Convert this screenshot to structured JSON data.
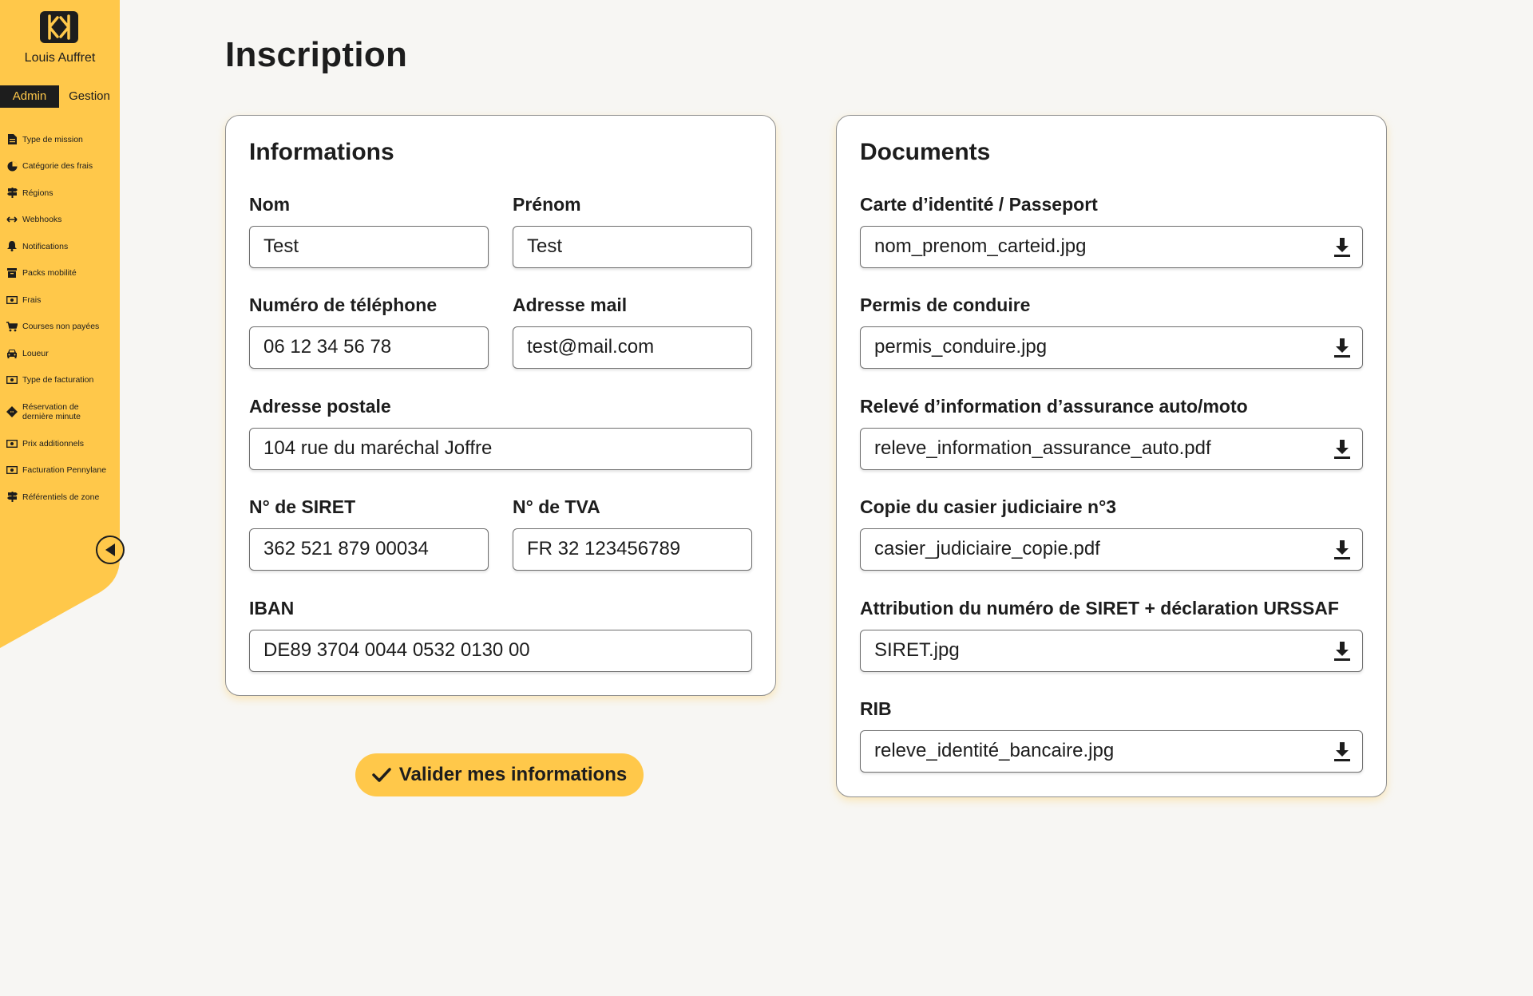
{
  "colors": {
    "accent": "#ffc84a",
    "dark": "#1d1d1d",
    "background": "#f7f6f3",
    "card": "#ffffff"
  },
  "sidebar": {
    "user_name": "Louis Auffret",
    "roles": {
      "admin": "Admin",
      "gestion": "Gestion"
    },
    "items": [
      {
        "label": "Type de mission",
        "icon": "document-icon"
      },
      {
        "label": "Catégorie des frais",
        "icon": "pie-chart-icon"
      },
      {
        "label": "Régions",
        "icon": "signpost-icon"
      },
      {
        "label": "Webhooks",
        "icon": "arrows-horizontal-icon"
      },
      {
        "label": "Notifications",
        "icon": "bell-icon"
      },
      {
        "label": "Packs mobilité",
        "icon": "package-icon"
      },
      {
        "label": "Frais",
        "icon": "money-icon"
      },
      {
        "label": "Courses non payées",
        "icon": "cart-icon"
      },
      {
        "label": "Loueur",
        "icon": "car-icon"
      },
      {
        "label": "Type de facturation",
        "icon": "money-icon"
      },
      {
        "label": "Réservation de dernière minute",
        "icon": "ticket-icon"
      },
      {
        "label": "Prix additionnels",
        "icon": "money-icon"
      },
      {
        "label": "Facturation Pennylane",
        "icon": "money-icon"
      },
      {
        "label": "Référentiels de zone",
        "icon": "signpost-icon"
      }
    ]
  },
  "page": {
    "title": "Inscription"
  },
  "informations": {
    "title": "Informations",
    "nom": {
      "label": "Nom",
      "value": "Test"
    },
    "prenom": {
      "label": "Prénom",
      "value": "Test"
    },
    "telephone": {
      "label": "Numéro de téléphone",
      "value": "06 12 34 56 78"
    },
    "email": {
      "label": "Adresse mail",
      "value": "test@mail.com"
    },
    "adresse": {
      "label": "Adresse postale",
      "value": "104 rue du maréchal Joffre"
    },
    "siret": {
      "label": "N° de SIRET",
      "value": "362 521 879 00034"
    },
    "tva": {
      "label": "N° de TVA",
      "value": "FR 32 123456789"
    },
    "iban": {
      "label": "IBAN",
      "value": "DE89 3704 0044 0532 0130 00"
    }
  },
  "documents": {
    "title": "Documents",
    "items": [
      {
        "label": "Carte d’identité / Passeport",
        "file": "nom_prenom_carteid.jpg"
      },
      {
        "label": "Permis de conduire",
        "file": "permis_conduire.jpg"
      },
      {
        "label": "Relevé d’information d’assurance auto/moto",
        "file": "releve_information_assurance_auto.pdf"
      },
      {
        "label": "Copie du casier judiciaire n°3",
        "file": "casier_judiciaire_copie.pdf"
      },
      {
        "label": "Attribution du numéro de SIRET + déclaration URSSAF",
        "file": "SIRET.jpg"
      },
      {
        "label": "RIB",
        "file": "releve_identité_bancaire.jpg"
      }
    ]
  },
  "submit": {
    "label": "Valider mes informations"
  }
}
